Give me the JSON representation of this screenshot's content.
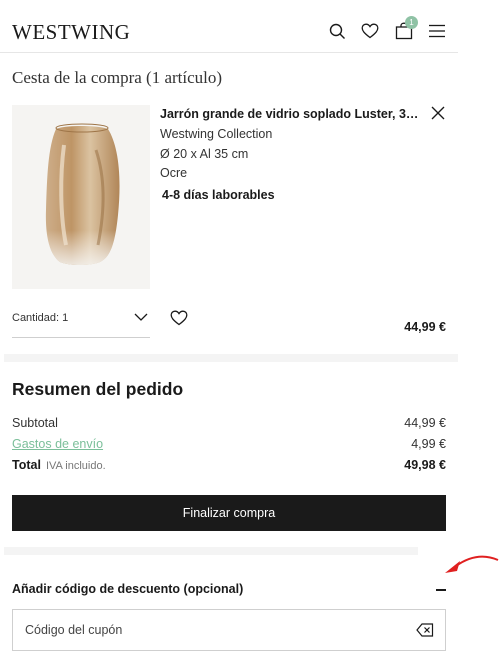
{
  "header": {
    "logo": "WESTWING",
    "cart_count": "1",
    "icons": [
      "search-icon",
      "heart-icon",
      "cart-icon",
      "menu-icon"
    ]
  },
  "cart": {
    "title": "Cesta de la compra (1 artículo)"
  },
  "item": {
    "name": "Jarrón grande de vidrio soplado Luster, 35 ...",
    "brand": "Westwing Collection",
    "size": "Ø 20 x Al 35 cm",
    "color": "Ocre",
    "delivery": "4-8 días laborables",
    "quantity_label": "Cantidad: 1",
    "price": "44,99 €"
  },
  "summary": {
    "title": "Resumen del pedido",
    "subtotal_label": "Subtotal",
    "subtotal_value": "44,99 €",
    "shipping_label": "Gastos de envío",
    "shipping_value": "4,99 €",
    "total_label": "Total",
    "vat_note": "IVA incluido.",
    "total_value": "49,98 €",
    "checkout_label": "Finalizar compra"
  },
  "discount": {
    "title": "Añadir código de descuento (opcional)",
    "coupon_placeholder": "Código del cupón"
  },
  "colors": {
    "accent": "#7bbf9a",
    "dark": "#1a1a1a",
    "annotation_arrow": "#e02020"
  }
}
